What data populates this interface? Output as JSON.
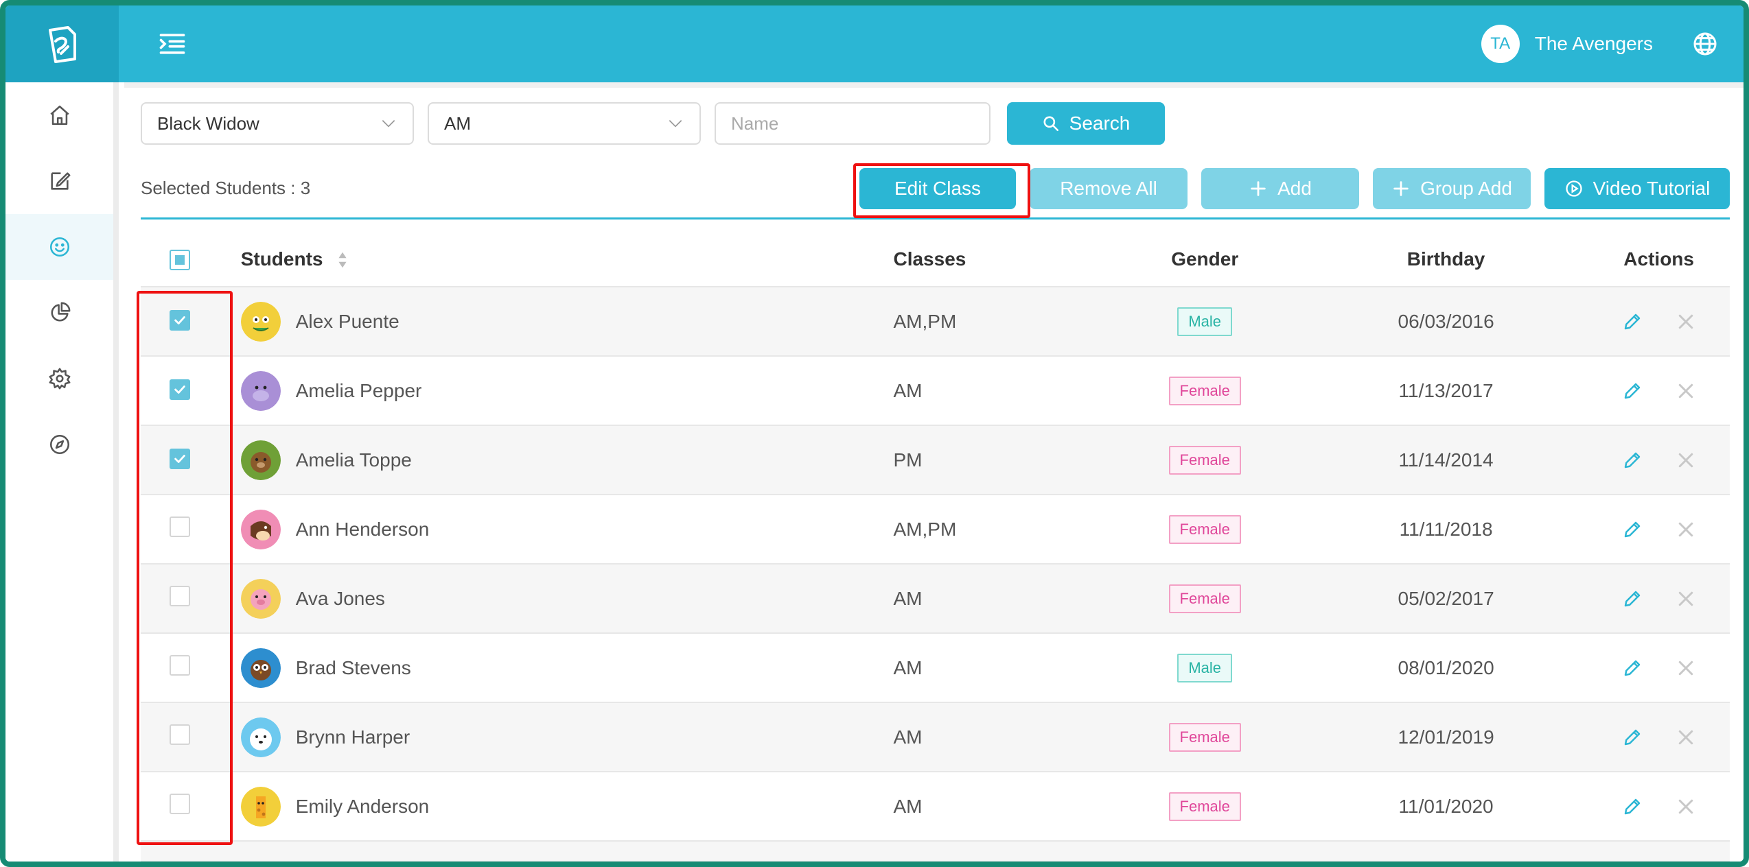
{
  "topbar": {
    "avatar_initials": "TA",
    "org_name": "The Avengers"
  },
  "sidebar": {
    "items": [
      {
        "name": "home",
        "icon": "home-icon"
      },
      {
        "name": "edit",
        "icon": "edit-icon"
      },
      {
        "name": "students",
        "icon": "smile-icon",
        "active": true
      },
      {
        "name": "reports",
        "icon": "pie-chart-icon"
      },
      {
        "name": "settings",
        "icon": "gear-icon"
      },
      {
        "name": "explore",
        "icon": "compass-icon"
      }
    ]
  },
  "filters": {
    "teacher_value": "Black Widow",
    "class_value": "AM",
    "name_placeholder": "Name",
    "search_label": "Search"
  },
  "toolbar": {
    "selected_label": "Selected Students : 3",
    "edit_class_label": "Edit Class",
    "remove_all_label": "Remove All",
    "add_label": "Add",
    "group_add_label": "Group Add",
    "video_tutorial_label": "Video Tutorial"
  },
  "table": {
    "headers": {
      "students": "Students",
      "classes": "Classes",
      "gender": "Gender",
      "birthday": "Birthday",
      "actions": "Actions"
    },
    "rows": [
      {
        "name": "Alex Puente",
        "classes": "AM,PM",
        "gender": "Male",
        "birthday": "06/03/2016",
        "checked": true,
        "avatar": "frog",
        "color": "#f2cf3a"
      },
      {
        "name": "Amelia Pepper",
        "classes": "AM",
        "gender": "Female",
        "birthday": "11/13/2017",
        "checked": true,
        "avatar": "hippo",
        "color": "#a98fd6"
      },
      {
        "name": "Amelia Toppe",
        "classes": "PM",
        "gender": "Female",
        "birthday": "11/14/2014",
        "checked": true,
        "avatar": "bear",
        "color": "#6fa037"
      },
      {
        "name": "Ann Henderson",
        "classes": "AM,PM",
        "gender": "Female",
        "birthday": "11/11/2018",
        "checked": false,
        "avatar": "cow",
        "color": "#f08db5"
      },
      {
        "name": "Ava Jones",
        "classes": "AM",
        "gender": "Female",
        "birthday": "05/02/2017",
        "checked": false,
        "avatar": "pig",
        "color": "#f4d05a"
      },
      {
        "name": "Brad Stevens",
        "classes": "AM",
        "gender": "Male",
        "birthday": "08/01/2020",
        "checked": false,
        "avatar": "owl",
        "color": "#2d8ecf"
      },
      {
        "name": "Brynn Harper",
        "classes": "AM",
        "gender": "Female",
        "birthday": "12/01/2019",
        "checked": false,
        "avatar": "polar-bear",
        "color": "#6dc9ef"
      },
      {
        "name": "Emily Anderson",
        "classes": "AM",
        "gender": "Female",
        "birthday": "11/01/2020",
        "checked": false,
        "avatar": "giraffe",
        "color": "#f2cf3a"
      }
    ]
  },
  "colors": {
    "primary": "#2bb6d4",
    "primary_light": "#7fd3e6",
    "frame": "#168b74",
    "male": "#28b3a4",
    "female": "#e0479a",
    "highlight": "#ee1111"
  }
}
